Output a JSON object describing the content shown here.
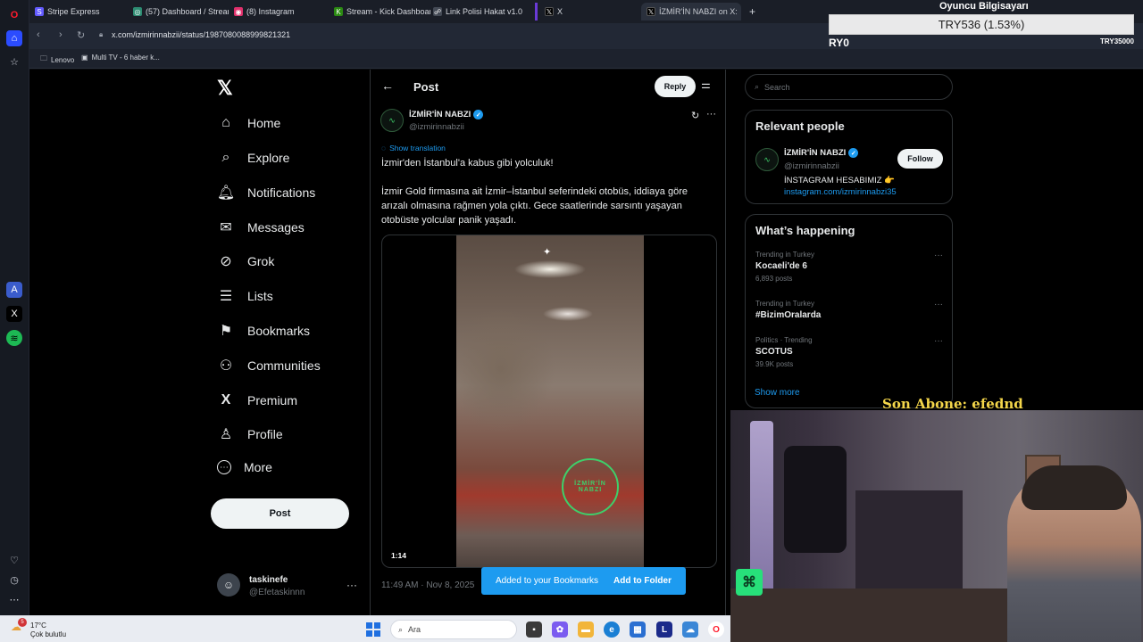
{
  "browser": {
    "tabs": [
      {
        "label": "Stripe Express",
        "color": "#635bff",
        "glyph": "S"
      },
      {
        "label": "(57) Dashboard / Streamlab",
        "color": "#80f5d2",
        "glyph": "◎"
      },
      {
        "label": "(8) Instagram",
        "color": "#e1306c",
        "glyph": "◉"
      },
      {
        "label": "Stream - Kick Dashboard",
        "color": "#53fc18",
        "glyph": "K"
      },
      {
        "label": "Link Polisi Hakat v1.0",
        "color": "#9aa0ab",
        "glyph": "☍"
      },
      {
        "label": "X",
        "color": "#000000",
        "glyph": "𝕏"
      },
      {
        "label": "İZMİR'İN NABZI on X:",
        "color": "#000000",
        "glyph": "𝕏"
      }
    ],
    "new_tab_icon": "+",
    "url": "x.com/izmirinnabzii/status/1987080088999821321",
    "bookmarks": [
      "Lenovo",
      "Multi TV - 6 haber k..."
    ]
  },
  "nav": {
    "items": [
      {
        "label": "Home",
        "icon": "⌂",
        "name": "nav-home"
      },
      {
        "label": "Explore",
        "icon": "⌕",
        "name": "nav-explore"
      },
      {
        "label": "Notifications",
        "icon": "🔔︎",
        "name": "nav-notifications"
      },
      {
        "label": "Messages",
        "icon": "✉",
        "name": "nav-messages"
      },
      {
        "label": "Grok",
        "icon": "⊘",
        "name": "nav-grok"
      },
      {
        "label": "Lists",
        "icon": "☰",
        "name": "nav-lists"
      },
      {
        "label": "Bookmarks",
        "icon": "⚑",
        "name": "nav-bookmarks"
      },
      {
        "label": "Communities",
        "icon": "⚇",
        "name": "nav-communities"
      },
      {
        "label": "Premium",
        "icon": "X",
        "name": "nav-premium"
      },
      {
        "label": "Profile",
        "icon": "♙",
        "name": "nav-profile"
      },
      {
        "label": "More",
        "icon": "⋯",
        "name": "nav-more"
      }
    ],
    "post_button": "Post",
    "account": {
      "name": "taskinefe",
      "handle": "@Efetaskinnn"
    }
  },
  "post": {
    "header_title": "Post",
    "reply_button": "Reply",
    "author_name": "İZMİR'İN NABZI",
    "author_handle": "@izmirinnabzii",
    "show_translation": "Show translation",
    "line1": "İzmir'den İstanbul'a kabus gibi yolculuk!",
    "body": "İzmir Gold firmasına ait İzmir–İstanbul seferindeki otobüs, iddiaya göre arızalı olmasına rağmen yola çıktı. Gece saatlerinde sarsıntı yaşayan otobüste yolcular panik yaşadı.",
    "video_duration": "1:14",
    "watermark": "İZMİR'İN NABZI",
    "timestamp": "11:49 AM · Nov 8, 2025",
    "toast": {
      "text": "Added to your Bookmarks",
      "action": "Add to Folder"
    }
  },
  "aside": {
    "search_placeholder": "Search",
    "relevant_title": "Relevant people",
    "person": {
      "name": "İZMİR'İN NABZI",
      "handle": "@izmirinnabzii",
      "bio": "İNSTAGRAM HESABIMIZ 👉",
      "link": "instagram.com/izmirinnabzi35",
      "follow": "Follow"
    },
    "happening_title": "What’s happening",
    "trends": [
      {
        "context": "Trending in Turkey",
        "title": "Kocaeli'de 6",
        "count": "6,893 posts"
      },
      {
        "context": "Trending in Turkey",
        "title": "#BizimOralarda",
        "count": ""
      },
      {
        "context": "Politics · Trending",
        "title": "SCOTUS",
        "count": "39.9K posts"
      }
    ],
    "show_more": "Show more"
  },
  "overlay": {
    "title": "Oyuncu Bilgisayarı",
    "ticker": "TRY536 (1.53%)",
    "ry0": "RY0",
    "try35": "TRY35000",
    "son_abone": "Son Abone: efednd"
  },
  "taskbar": {
    "temp": "17°C",
    "weather": "Çok bulutlu",
    "badge": "5",
    "search": "Ara"
  }
}
